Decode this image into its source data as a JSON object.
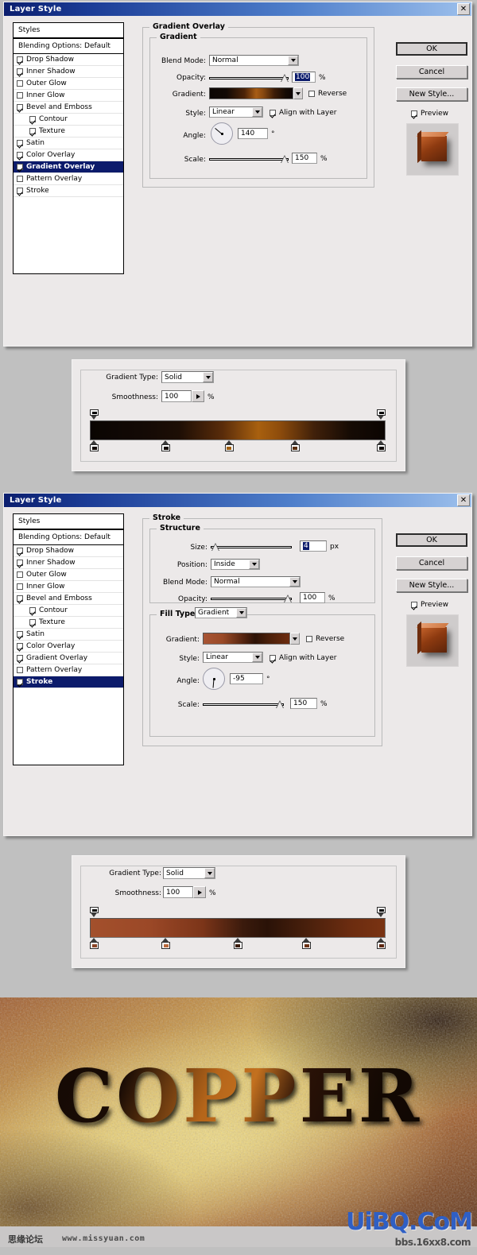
{
  "page": {
    "background": "#c0c0c0"
  },
  "dialog1": {
    "title": "Layer Style",
    "close_icon": "close-icon",
    "styles_panel": {
      "header": "Styles",
      "blending_options": "Blending Options: Default",
      "items": [
        {
          "label": "Drop Shadow",
          "checked": true,
          "sub": false,
          "selected": false
        },
        {
          "label": "Inner Shadow",
          "checked": true,
          "sub": false,
          "selected": false
        },
        {
          "label": "Outer Glow",
          "checked": false,
          "sub": false,
          "selected": false
        },
        {
          "label": "Inner Glow",
          "checked": false,
          "sub": false,
          "selected": false
        },
        {
          "label": "Bevel and Emboss",
          "checked": true,
          "sub": false,
          "selected": false
        },
        {
          "label": "Contour",
          "checked": true,
          "sub": true,
          "selected": false
        },
        {
          "label": "Texture",
          "checked": true,
          "sub": true,
          "selected": false
        },
        {
          "label": "Satin",
          "checked": true,
          "sub": false,
          "selected": false
        },
        {
          "label": "Color Overlay",
          "checked": true,
          "sub": false,
          "selected": false
        },
        {
          "label": "Gradient Overlay",
          "checked": true,
          "sub": false,
          "selected": true
        },
        {
          "label": "Pattern Overlay",
          "checked": false,
          "sub": false,
          "selected": false
        },
        {
          "label": "Stroke",
          "checked": true,
          "sub": false,
          "selected": false
        }
      ]
    },
    "panel": {
      "section_title": "Gradient Overlay",
      "group_title": "Gradient",
      "blend_mode_label": "Blend Mode:",
      "blend_mode_value": "Normal",
      "opacity_label": "Opacity:",
      "opacity_value": "100",
      "opacity_unit": "%",
      "gradient_label": "Gradient:",
      "gradient_css": "linear-gradient(to right,#0b0603 0%,#120905 20%,#4d2408 42%,#a85c14 56%,#8a4a10 64%,#3c1c07 78%,#140a04 92%,#0d0502 100%)",
      "reverse_label": "Reverse",
      "reverse_checked": false,
      "style_label": "Style:",
      "style_value": "Linear",
      "align_label": "Align with Layer",
      "align_checked": true,
      "angle_label": "Angle:",
      "angle_value": "140",
      "angle_unit": "°",
      "scale_label": "Scale:",
      "scale_value": "150",
      "scale_unit": "%"
    },
    "buttons": {
      "ok": "OK",
      "cancel": "Cancel",
      "new_style": "New Style...",
      "preview_label": "Preview",
      "preview_checked": true
    }
  },
  "gradient_editor1": {
    "gradient_type_label": "Gradient Type:",
    "gradient_type_value": "Solid",
    "smoothness_label": "Smoothness:",
    "smoothness_value": "100",
    "smoothness_unit": "%",
    "bar_css": "linear-gradient(to right,#0a0502 0%,#120905 16%,#1d0e05 30%,#5a2c0a 45%,#a8600f 57%,#8f4d0c 64%,#40200a 76%,#160b04 88%,#0b0502 100%)",
    "opacity_stops": [
      {
        "pos": 0,
        "color": "#000000"
      },
      {
        "pos": 100,
        "color": "#000000"
      }
    ],
    "color_stops": [
      {
        "pos": 0,
        "color": "#120905"
      },
      {
        "pos": 25,
        "color": "#140a05"
      },
      {
        "pos": 47,
        "color": "#a1600f"
      },
      {
        "pos": 70,
        "color": "#5b2f0c"
      },
      {
        "pos": 100,
        "color": "#0d0603"
      }
    ]
  },
  "dialog2": {
    "title": "Layer Style",
    "close_icon": "close-icon",
    "styles_panel": {
      "header": "Styles",
      "blending_options": "Blending Options: Default",
      "items": [
        {
          "label": "Drop Shadow",
          "checked": true,
          "sub": false,
          "selected": false
        },
        {
          "label": "Inner Shadow",
          "checked": true,
          "sub": false,
          "selected": false
        },
        {
          "label": "Outer Glow",
          "checked": false,
          "sub": false,
          "selected": false
        },
        {
          "label": "Inner Glow",
          "checked": false,
          "sub": false,
          "selected": false
        },
        {
          "label": "Bevel and Emboss",
          "checked": true,
          "sub": false,
          "selected": false
        },
        {
          "label": "Contour",
          "checked": true,
          "sub": true,
          "selected": false
        },
        {
          "label": "Texture",
          "checked": true,
          "sub": true,
          "selected": false
        },
        {
          "label": "Satin",
          "checked": true,
          "sub": false,
          "selected": false
        },
        {
          "label": "Color Overlay",
          "checked": true,
          "sub": false,
          "selected": false
        },
        {
          "label": "Gradient Overlay",
          "checked": true,
          "sub": false,
          "selected": false
        },
        {
          "label": "Pattern Overlay",
          "checked": false,
          "sub": false,
          "selected": false
        },
        {
          "label": "Stroke",
          "checked": true,
          "sub": false,
          "selected": true
        }
      ]
    },
    "panel": {
      "section_title": "Stroke",
      "structure_title": "Structure",
      "size_label": "Size:",
      "size_value": "4",
      "size_unit": "px",
      "position_label": "Position:",
      "position_value": "Inside",
      "blend_mode_label": "Blend Mode:",
      "blend_mode_value": "Normal",
      "opacity_label": "Opacity:",
      "opacity_value": "100",
      "opacity_unit": "%",
      "fill_type_label": "Fill Type:",
      "fill_type_value": "Gradient",
      "gradient_label": "Gradient:",
      "gradient_css": "linear-gradient(to right,#a85434 0%,#9a4a27 22%,#50220f 48%,#2c1206 60%,#4a1f0a 76%,#6d2c0f 100%)",
      "reverse_label": "Reverse",
      "reverse_checked": false,
      "style_label": "Style:",
      "style_value": "Linear",
      "align_label": "Align with Layer",
      "align_checked": true,
      "angle_label": "Angle:",
      "angle_value": "-95",
      "angle_unit": "°",
      "scale_label": "Scale:",
      "scale_value": "150",
      "scale_unit": "%"
    },
    "buttons": {
      "ok": "OK",
      "cancel": "Cancel",
      "new_style": "New Style...",
      "preview_label": "Preview",
      "preview_checked": true
    }
  },
  "gradient_editor2": {
    "gradient_type_label": "Gradient Type:",
    "gradient_type_value": "Solid",
    "smoothness_label": "Smoothness:",
    "smoothness_value": "100",
    "smoothness_unit": "%",
    "bar_css": "linear-gradient(to right,#a3502c 0%,#9b4827 20%,#7c3519 38%,#3a1a0c 52%,#2a1207 60%,#4a200c 74%,#6b2c10 88%,#7a3312 100%)",
    "opacity_stops": [
      {
        "pos": 0,
        "color": "#000000"
      },
      {
        "pos": 100,
        "color": "#000000"
      }
    ],
    "color_stops": [
      {
        "pos": 0,
        "color": "#8b4526"
      },
      {
        "pos": 25,
        "color": "#b8693c"
      },
      {
        "pos": 50,
        "color": "#3a1c0c"
      },
      {
        "pos": 74,
        "color": "#6d3316"
      },
      {
        "pos": 100,
        "color": "#5c2610"
      }
    ]
  },
  "artwork": {
    "text": "COPPER",
    "alt": "rusted copper textured background with COPPER lettering"
  },
  "watermarks": {
    "cn_forum": "思缘论坛",
    "site_url": "www.missyuan.com",
    "uibq": "UiBQ.CoM",
    "bbs": "bbs.16xx8.com"
  }
}
